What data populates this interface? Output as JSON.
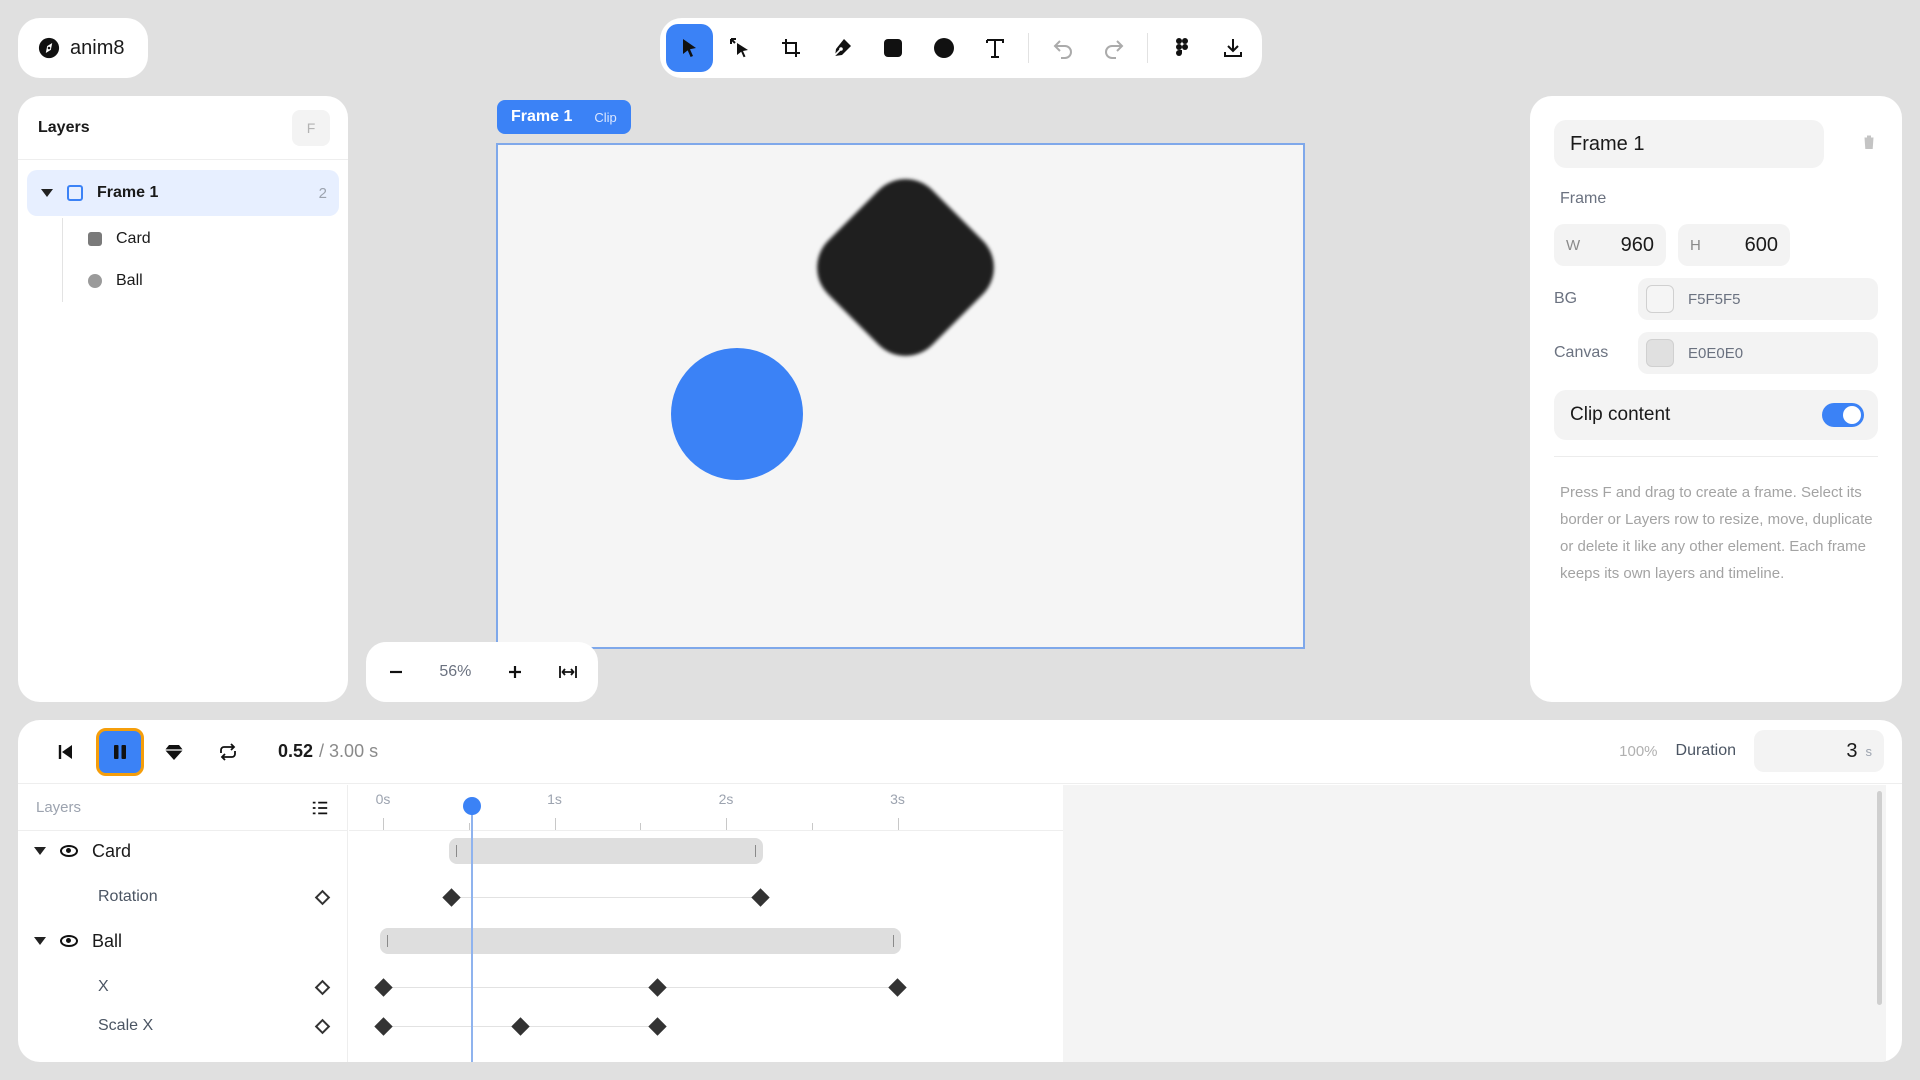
{
  "app": {
    "name": "anim8"
  },
  "toolbar": {
    "tools": [
      {
        "name": "select-tool",
        "icon": "pointer-icon",
        "active": true
      },
      {
        "name": "direct-select-tool",
        "icon": "direct-select-icon",
        "active": false
      },
      {
        "name": "frame-tool",
        "icon": "frame-icon",
        "active": false
      },
      {
        "name": "pen-tool",
        "icon": "pen-icon",
        "active": false
      },
      {
        "name": "rectangle-tool",
        "icon": "rectangle-icon",
        "active": false
      },
      {
        "name": "ellipse-tool",
        "icon": "ellipse-icon",
        "active": false
      },
      {
        "name": "text-tool",
        "icon": "text-icon",
        "active": false
      },
      {
        "name": "undo-button",
        "icon": "undo-icon",
        "disabled": true
      },
      {
        "name": "redo-button",
        "icon": "redo-icon",
        "disabled": true
      },
      {
        "name": "figma-import-button",
        "icon": "figma-icon"
      },
      {
        "name": "export-button",
        "icon": "download-icon"
      }
    ]
  },
  "layers_panel": {
    "title": "Layers",
    "shortcut": "F",
    "frame": {
      "label": "Frame 1",
      "count": "2"
    },
    "children": [
      {
        "label": "Card",
        "icon": "square-icon"
      },
      {
        "label": "Ball",
        "icon": "circle-icon"
      }
    ]
  },
  "canvas": {
    "frame_name": "Frame 1",
    "clip_tag": "Clip",
    "colors": {
      "frame_bg": "#F5F5F5",
      "card": "#1F1F1F",
      "ball": "#3B82F6"
    }
  },
  "zoom": {
    "value": "56%"
  },
  "properties": {
    "title": "Frame 1",
    "section": "Frame",
    "w_label": "W",
    "w_value": "960",
    "h_label": "H",
    "h_value": "600",
    "bg_label": "BG",
    "bg_value": "F5F5F5",
    "canvas_label": "Canvas",
    "canvas_value": "E0E0E0",
    "clip_label": "Clip content",
    "clip_enabled": true,
    "help": "Press F and drag to create a frame. Select its border or Layers row to resize, move, duplicate or delete it like any other element. Each frame keeps its own layers and timeline."
  },
  "timeline": {
    "current_time": "0.52",
    "total_time": "/ 3.00 s",
    "speed": "100%",
    "duration_label": "Duration",
    "duration_value": "3",
    "duration_unit": "s",
    "layers_header": "Layers",
    "ruler": [
      "0s",
      "1s",
      "2s",
      "3s"
    ],
    "duration_seconds": 3,
    "playhead_seconds": 0.52,
    "groups": [
      {
        "label": "Card",
        "clip": [
          0.4,
          2.2
        ],
        "tracks": [
          {
            "label": "Rotation",
            "keyframes": [
              0.4,
              2.2
            ]
          }
        ]
      },
      {
        "label": "Ball",
        "clip": [
          0.0,
          3.0
        ],
        "tracks": [
          {
            "label": "X",
            "keyframes": [
              0.0,
              1.6,
              3.0
            ]
          },
          {
            "label": "Scale X",
            "keyframes": [
              0.0,
              0.8,
              1.6
            ]
          }
        ]
      }
    ]
  }
}
